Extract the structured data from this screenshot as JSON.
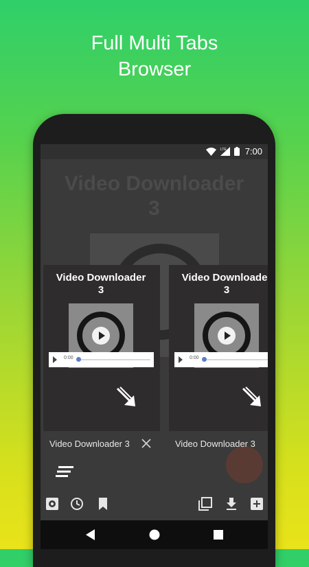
{
  "headline": {
    "line1": "Full Multi Tabs",
    "line2": "Browser"
  },
  "status_bar": {
    "time": "7:00",
    "icons": [
      "wifi-icon",
      "lte-signal-icon",
      "battery-icon"
    ]
  },
  "background_page": {
    "title_line1": "Video Downloader",
    "title_line2": "3"
  },
  "tabs": [
    {
      "preview_title_line1": "Video Downloader",
      "preview_title_line2": "3",
      "audio_time": "0:00",
      "label": "Video Downloader 3",
      "closable": true
    },
    {
      "preview_title_line1": "Video Downloader",
      "preview_title_line2": "3",
      "audio_time": "0:00",
      "label": "Video Downloader 3",
      "closable": false
    }
  ],
  "toolbar": {
    "left": [
      "settings-icon",
      "history-icon",
      "bookmark-icon"
    ],
    "right": [
      "tabs-icon",
      "download-icon",
      "new-tab-icon"
    ]
  },
  "nav_bar": [
    "back-icon",
    "home-icon",
    "recents-icon"
  ],
  "colors": {
    "accent_arrow": "#ffffff",
    "card_bg": "#2e2c2d",
    "screen_bg": "#3a3a3a"
  }
}
